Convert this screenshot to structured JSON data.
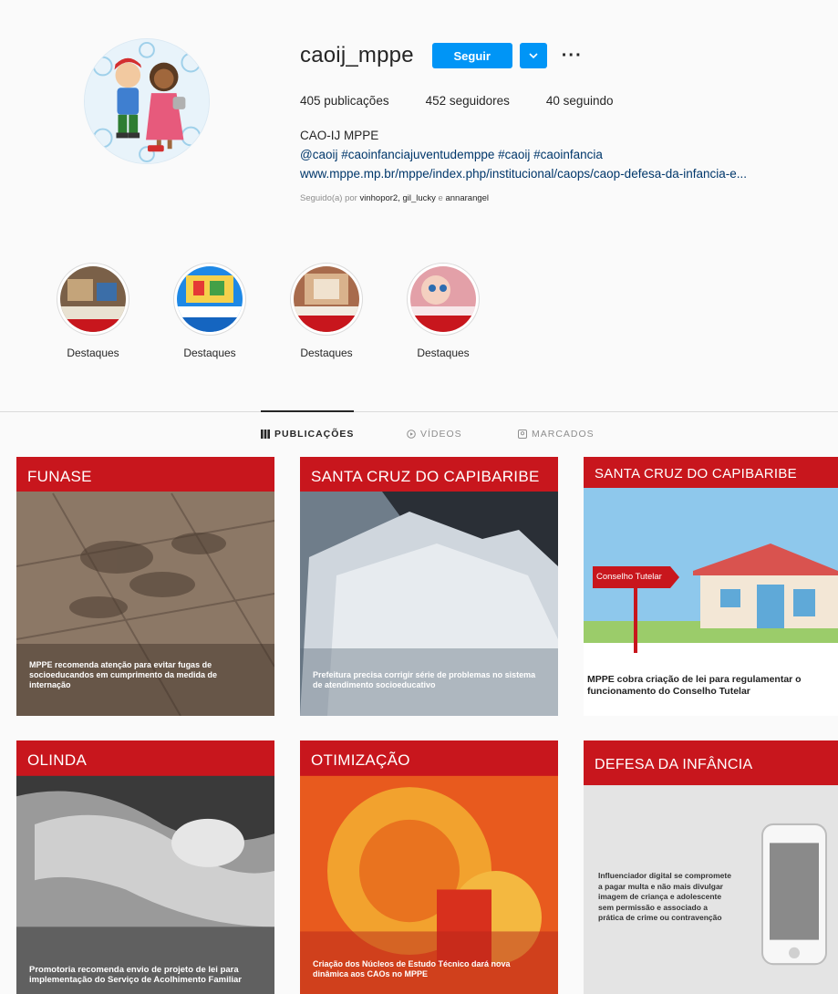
{
  "profile": {
    "username": "caoij_mppe",
    "follow_label": "Seguir",
    "more_label": "···",
    "stats": {
      "posts": "405 publicações",
      "followers": "452 seguidores",
      "following": "40 seguindo"
    },
    "bio_name": "CAO-IJ MPPE",
    "bio_tags": "@caoij #caoinfanciajuventudemppe #caoij #caoinfancia",
    "bio_link": "www.mppe.mp.br/mppe/index.php/institucional/caops/caop-defesa-da-infancia-e...",
    "followed_prefix": "Seguido(a) por ",
    "followed_users": "vinhopor2, gil_lucky",
    "followed_and": " e ",
    "followed_last": "annarangel"
  },
  "highlights": [
    {
      "label": "Destaques"
    },
    {
      "label": "Destaques"
    },
    {
      "label": "Destaques"
    },
    {
      "label": "Destaques"
    }
  ],
  "tabs": [
    {
      "label": "PUBLICAÇÕES",
      "icon": "grid-icon",
      "active": true
    },
    {
      "label": "VÍDEOS",
      "icon": "video-icon",
      "active": false
    },
    {
      "label": "MARCADOS",
      "icon": "tag-icon",
      "active": false
    }
  ],
  "posts": [
    {
      "title": "FUNASE",
      "caption": "MPPE recomenda atenção para evitar fugas de socioeducandos em cumprimento da medida de internação"
    },
    {
      "title": "SANTA CRUZ DO CAPIBARIBE",
      "caption": "Prefeitura precisa corrigir série de problemas no sistema de atendimento socioeducativo"
    },
    {
      "title": "SANTA CRUZ DO CAPIBARIBE",
      "caption": "MPPE cobra criação de lei para regulamentar o funcionamento do Conselho Tutelar",
      "sign": "Conselho Tutelar"
    },
    {
      "title": "OLINDA",
      "caption": "Promotoria recomenda envio de projeto de lei para implementação do Serviço de Acolhimento Familiar"
    },
    {
      "title": "OTIMIZAÇÃO",
      "caption": "Criação dos Núcleos de Estudo Técnico dará nova dinâmica aos CAOs no MPPE"
    },
    {
      "title": "DEFESA DA INFÂNCIA",
      "caption": "Influenciador digital se compromete a pagar multa e não mais divulgar imagem de criança e adolescente sem permissão e associado a prática de crime ou contravenção"
    }
  ],
  "colors": {
    "follow_blue": "#0095f6",
    "brand_red": "#c8161d",
    "link": "#00376b"
  }
}
